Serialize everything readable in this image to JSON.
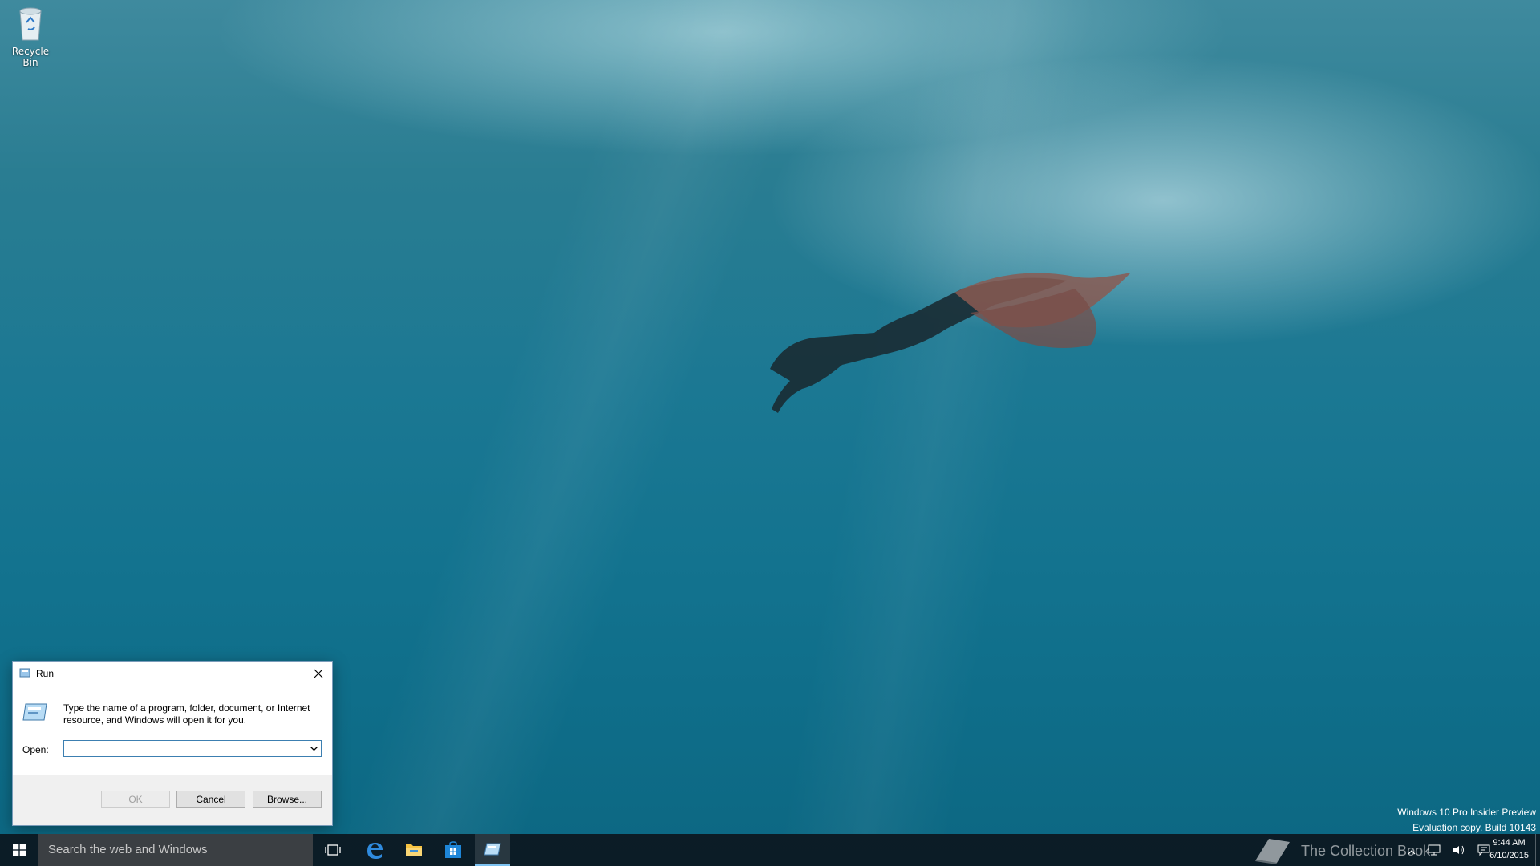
{
  "desktop": {
    "icons": [
      {
        "label": "Recycle Bin",
        "icon": "recycle-bin-icon"
      }
    ],
    "watermark": {
      "line1": "Windows 10 Pro Insider Preview",
      "line2": "Evaluation copy. Build 10143"
    }
  },
  "run_dialog": {
    "title": "Run",
    "description": "Type the name of a program, folder, document, or Internet resource, and Windows will open it for you.",
    "open_label": "Open:",
    "open_value": "",
    "buttons": {
      "ok": "OK",
      "cancel": "Cancel",
      "browse": "Browse..."
    }
  },
  "taskbar": {
    "search_placeholder": "Search the web and Windows",
    "pinned": [
      "task-view-icon",
      "edge-icon",
      "file-explorer-icon",
      "store-icon",
      "run-icon"
    ],
    "accent_color": "#7ec3f2"
  },
  "tray": {
    "brand": "The Collection Book",
    "time": "9:44 AM",
    "date": "6/10/2015"
  }
}
